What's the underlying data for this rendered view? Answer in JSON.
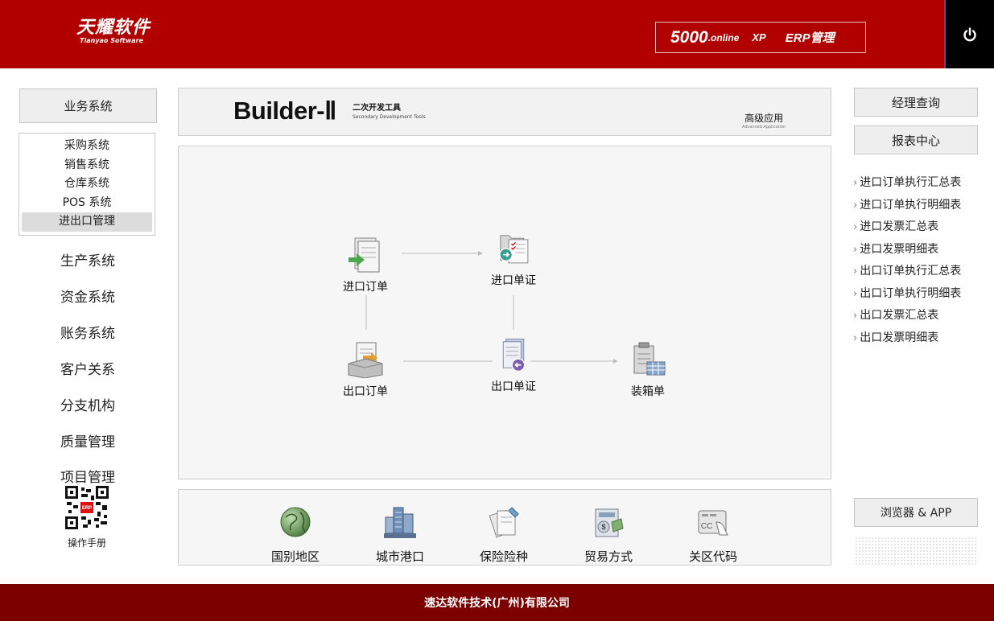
{
  "header": {
    "logo_cn": "天耀软件",
    "logo_en": "Tianyao Software",
    "version_num": "5000",
    "version_online": ".online",
    "version_xp": "XP",
    "version_erp": "ERP管理",
    "power_icon": "power-icon",
    "bg_color": "#b10000"
  },
  "sidebar": {
    "business_button": "业务系统",
    "sub_items": [
      {
        "label": "采购系统"
      },
      {
        "label": "销售系统"
      },
      {
        "label": "仓库系统"
      },
      {
        "label": "POS 系统"
      },
      {
        "label": "进出口管理",
        "active": true
      }
    ],
    "nav_items": [
      {
        "label": "生产系统"
      },
      {
        "label": "资金系统"
      },
      {
        "label": "账务系统"
      },
      {
        "label": "客户关系"
      },
      {
        "label": "分支机构"
      },
      {
        "label": "质量管理"
      },
      {
        "label": "项目管理"
      }
    ],
    "qr_icon": "qr-code-icon",
    "manual_label": "操作手册"
  },
  "banner": {
    "title": "Builder-Ⅱ",
    "subtitle_cn": "二次开发工具",
    "subtitle_en": "Secondary Development Tools",
    "advanced_cn": "高级应用",
    "advanced_en": "Advanced Application"
  },
  "flow": {
    "nodes": [
      {
        "label": "进口订单",
        "icon": "import-order-icon"
      },
      {
        "label": "进口单证",
        "icon": "import-document-icon"
      },
      {
        "label": "出口订单",
        "icon": "export-order-icon"
      },
      {
        "label": "出口单证",
        "icon": "export-document-icon"
      },
      {
        "label": "装箱单",
        "icon": "packing-list-icon"
      }
    ]
  },
  "tools": [
    {
      "label": "国别地区",
      "icon": "globe-icon"
    },
    {
      "label": "城市港口",
      "icon": "city-port-icon"
    },
    {
      "label": "保险险种",
      "icon": "insurance-icon"
    },
    {
      "label": "贸易方式",
      "icon": "trade-method-icon"
    },
    {
      "label": "关区代码",
      "icon": "customs-code-icon"
    }
  ],
  "right": {
    "manager_query": "经理查询",
    "report_center": "报表中心",
    "reports": [
      "进口订单执行汇总表",
      "进口订单执行明细表",
      "进口发票汇总表",
      "进口发票明细表",
      "出口订单执行汇总表",
      "出口订单执行明细表",
      "出口发票汇总表",
      "出口发票明细表"
    ],
    "arrow": "›",
    "browser_app": "浏览器 & APP"
  },
  "footer": {
    "company": "速达软件技术(广州)有限公司",
    "bg_color": "#7c0000"
  }
}
